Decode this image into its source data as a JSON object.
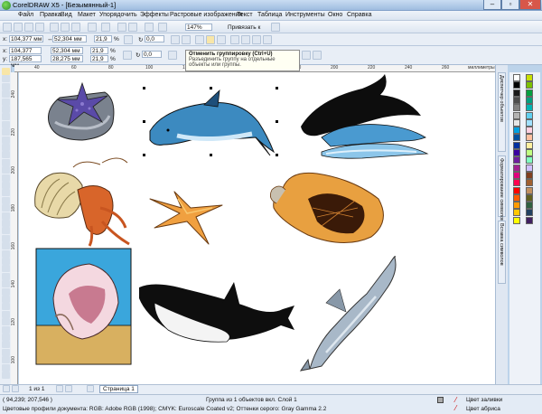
{
  "window": {
    "title": "CorelDRAW X5 - [Безымянный-1]"
  },
  "menu": {
    "items": [
      "Файл",
      "Правка",
      "Вид",
      "Макет",
      "Упорядочить",
      "Эффекты",
      "Растровые изображения",
      "Текст",
      "Таблица",
      "Инструменты",
      "Окно",
      "Справка"
    ]
  },
  "toolbar": {
    "zoom": "147%",
    "snap": "Привязать к"
  },
  "propbar": {
    "x": "104,377 мм",
    "y": "187,565 мм",
    "w": "52,304 мм",
    "h": "28,275 мм",
    "sx": "21,9",
    "sy": "21,9",
    "pct": "%",
    "angle": "0,0",
    "unit": "мм"
  },
  "tooltip": {
    "title": "Отменить группировку (Ctrl+U)",
    "desc": "Разъединить группу на отдельные объекты или группы."
  },
  "ruler": {
    "h": [
      "40",
      "60",
      "80",
      "100",
      "120",
      "140",
      "160",
      "180",
      "200",
      "220",
      "240",
      "260"
    ],
    "h_unit": "миллиметры",
    "v": [
      "240",
      "220",
      "200",
      "180",
      "160",
      "140",
      "120",
      "100"
    ]
  },
  "dockers": {
    "tabs": [
      "Диспетчер объектов",
      "Форматирование символов",
      "Вставка символов"
    ]
  },
  "palette": {
    "colors": [
      "#ffffff",
      "#000000",
      "#1a1a1a",
      "#4d4d4d",
      "#808080",
      "#b3b3b3",
      "#e6e6e6",
      "#00a0e0",
      "#00509f",
      "#0030a0",
      "#3a00a0",
      "#6e1e9e",
      "#a02090",
      "#e0007e",
      "#ff0050",
      "#ff0000",
      "#ff5a00",
      "#ff9a00",
      "#ffc800",
      "#ffff00",
      "#c8e000",
      "#7cc000",
      "#00a040",
      "#00a080",
      "#00b4b4",
      "#60d0f0",
      "#a0e0ff",
      "#ffd0e0",
      "#ffc0a0",
      "#fff0a0",
      "#c0ff80",
      "#80ffc0",
      "#d0c0ff",
      "#804020",
      "#a06030",
      "#c09060",
      "#606020",
      "#306040",
      "#204060",
      "#402060"
    ]
  },
  "pagebar": {
    "count": "1 из 1",
    "page": "Страница 1"
  },
  "status": {
    "coords": "( 94,239; 207,546 )",
    "info": "Группа из 1 объектов вкл. Слой 1",
    "fill": "Цвет заливки",
    "outline": "Цвет абриса",
    "profiles": "Цветовые профили документа: RGB: Adobe RGB (1998); CMYK: Euroscale Coated v2; Оттенки серого: Gray Gamma 2.2"
  }
}
